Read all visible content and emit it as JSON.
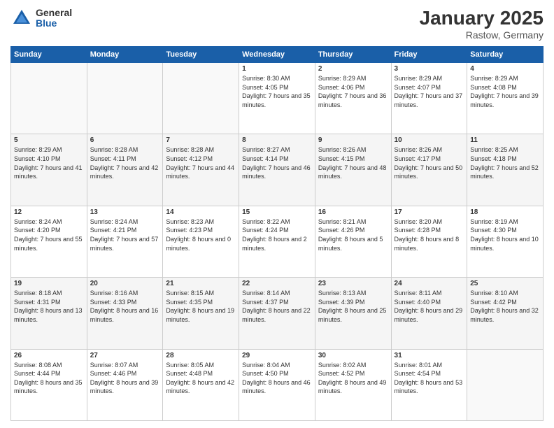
{
  "header": {
    "logo_general": "General",
    "logo_blue": "Blue",
    "title": "January 2025",
    "subtitle": "Rastow, Germany"
  },
  "weekdays": [
    "Sunday",
    "Monday",
    "Tuesday",
    "Wednesday",
    "Thursday",
    "Friday",
    "Saturday"
  ],
  "weeks": [
    [
      {
        "day": "",
        "sunrise": "",
        "sunset": "",
        "daylight": ""
      },
      {
        "day": "",
        "sunrise": "",
        "sunset": "",
        "daylight": ""
      },
      {
        "day": "",
        "sunrise": "",
        "sunset": "",
        "daylight": ""
      },
      {
        "day": "1",
        "sunrise": "Sunrise: 8:30 AM",
        "sunset": "Sunset: 4:05 PM",
        "daylight": "Daylight: 7 hours and 35 minutes."
      },
      {
        "day": "2",
        "sunrise": "Sunrise: 8:29 AM",
        "sunset": "Sunset: 4:06 PM",
        "daylight": "Daylight: 7 hours and 36 minutes."
      },
      {
        "day": "3",
        "sunrise": "Sunrise: 8:29 AM",
        "sunset": "Sunset: 4:07 PM",
        "daylight": "Daylight: 7 hours and 37 minutes."
      },
      {
        "day": "4",
        "sunrise": "Sunrise: 8:29 AM",
        "sunset": "Sunset: 4:08 PM",
        "daylight": "Daylight: 7 hours and 39 minutes."
      }
    ],
    [
      {
        "day": "5",
        "sunrise": "Sunrise: 8:29 AM",
        "sunset": "Sunset: 4:10 PM",
        "daylight": "Daylight: 7 hours and 41 minutes."
      },
      {
        "day": "6",
        "sunrise": "Sunrise: 8:28 AM",
        "sunset": "Sunset: 4:11 PM",
        "daylight": "Daylight: 7 hours and 42 minutes."
      },
      {
        "day": "7",
        "sunrise": "Sunrise: 8:28 AM",
        "sunset": "Sunset: 4:12 PM",
        "daylight": "Daylight: 7 hours and 44 minutes."
      },
      {
        "day": "8",
        "sunrise": "Sunrise: 8:27 AM",
        "sunset": "Sunset: 4:14 PM",
        "daylight": "Daylight: 7 hours and 46 minutes."
      },
      {
        "day": "9",
        "sunrise": "Sunrise: 8:26 AM",
        "sunset": "Sunset: 4:15 PM",
        "daylight": "Daylight: 7 hours and 48 minutes."
      },
      {
        "day": "10",
        "sunrise": "Sunrise: 8:26 AM",
        "sunset": "Sunset: 4:17 PM",
        "daylight": "Daylight: 7 hours and 50 minutes."
      },
      {
        "day": "11",
        "sunrise": "Sunrise: 8:25 AM",
        "sunset": "Sunset: 4:18 PM",
        "daylight": "Daylight: 7 hours and 52 minutes."
      }
    ],
    [
      {
        "day": "12",
        "sunrise": "Sunrise: 8:24 AM",
        "sunset": "Sunset: 4:20 PM",
        "daylight": "Daylight: 7 hours and 55 minutes."
      },
      {
        "day": "13",
        "sunrise": "Sunrise: 8:24 AM",
        "sunset": "Sunset: 4:21 PM",
        "daylight": "Daylight: 7 hours and 57 minutes."
      },
      {
        "day": "14",
        "sunrise": "Sunrise: 8:23 AM",
        "sunset": "Sunset: 4:23 PM",
        "daylight": "Daylight: 8 hours and 0 minutes."
      },
      {
        "day": "15",
        "sunrise": "Sunrise: 8:22 AM",
        "sunset": "Sunset: 4:24 PM",
        "daylight": "Daylight: 8 hours and 2 minutes."
      },
      {
        "day": "16",
        "sunrise": "Sunrise: 8:21 AM",
        "sunset": "Sunset: 4:26 PM",
        "daylight": "Daylight: 8 hours and 5 minutes."
      },
      {
        "day": "17",
        "sunrise": "Sunrise: 8:20 AM",
        "sunset": "Sunset: 4:28 PM",
        "daylight": "Daylight: 8 hours and 8 minutes."
      },
      {
        "day": "18",
        "sunrise": "Sunrise: 8:19 AM",
        "sunset": "Sunset: 4:30 PM",
        "daylight": "Daylight: 8 hours and 10 minutes."
      }
    ],
    [
      {
        "day": "19",
        "sunrise": "Sunrise: 8:18 AM",
        "sunset": "Sunset: 4:31 PM",
        "daylight": "Daylight: 8 hours and 13 minutes."
      },
      {
        "day": "20",
        "sunrise": "Sunrise: 8:16 AM",
        "sunset": "Sunset: 4:33 PM",
        "daylight": "Daylight: 8 hours and 16 minutes."
      },
      {
        "day": "21",
        "sunrise": "Sunrise: 8:15 AM",
        "sunset": "Sunset: 4:35 PM",
        "daylight": "Daylight: 8 hours and 19 minutes."
      },
      {
        "day": "22",
        "sunrise": "Sunrise: 8:14 AM",
        "sunset": "Sunset: 4:37 PM",
        "daylight": "Daylight: 8 hours and 22 minutes."
      },
      {
        "day": "23",
        "sunrise": "Sunrise: 8:13 AM",
        "sunset": "Sunset: 4:39 PM",
        "daylight": "Daylight: 8 hours and 25 minutes."
      },
      {
        "day": "24",
        "sunrise": "Sunrise: 8:11 AM",
        "sunset": "Sunset: 4:40 PM",
        "daylight": "Daylight: 8 hours and 29 minutes."
      },
      {
        "day": "25",
        "sunrise": "Sunrise: 8:10 AM",
        "sunset": "Sunset: 4:42 PM",
        "daylight": "Daylight: 8 hours and 32 minutes."
      }
    ],
    [
      {
        "day": "26",
        "sunrise": "Sunrise: 8:08 AM",
        "sunset": "Sunset: 4:44 PM",
        "daylight": "Daylight: 8 hours and 35 minutes."
      },
      {
        "day": "27",
        "sunrise": "Sunrise: 8:07 AM",
        "sunset": "Sunset: 4:46 PM",
        "daylight": "Daylight: 8 hours and 39 minutes."
      },
      {
        "day": "28",
        "sunrise": "Sunrise: 8:05 AM",
        "sunset": "Sunset: 4:48 PM",
        "daylight": "Daylight: 8 hours and 42 minutes."
      },
      {
        "day": "29",
        "sunrise": "Sunrise: 8:04 AM",
        "sunset": "Sunset: 4:50 PM",
        "daylight": "Daylight: 8 hours and 46 minutes."
      },
      {
        "day": "30",
        "sunrise": "Sunrise: 8:02 AM",
        "sunset": "Sunset: 4:52 PM",
        "daylight": "Daylight: 8 hours and 49 minutes."
      },
      {
        "day": "31",
        "sunrise": "Sunrise: 8:01 AM",
        "sunset": "Sunset: 4:54 PM",
        "daylight": "Daylight: 8 hours and 53 minutes."
      },
      {
        "day": "",
        "sunrise": "",
        "sunset": "",
        "daylight": ""
      }
    ]
  ]
}
